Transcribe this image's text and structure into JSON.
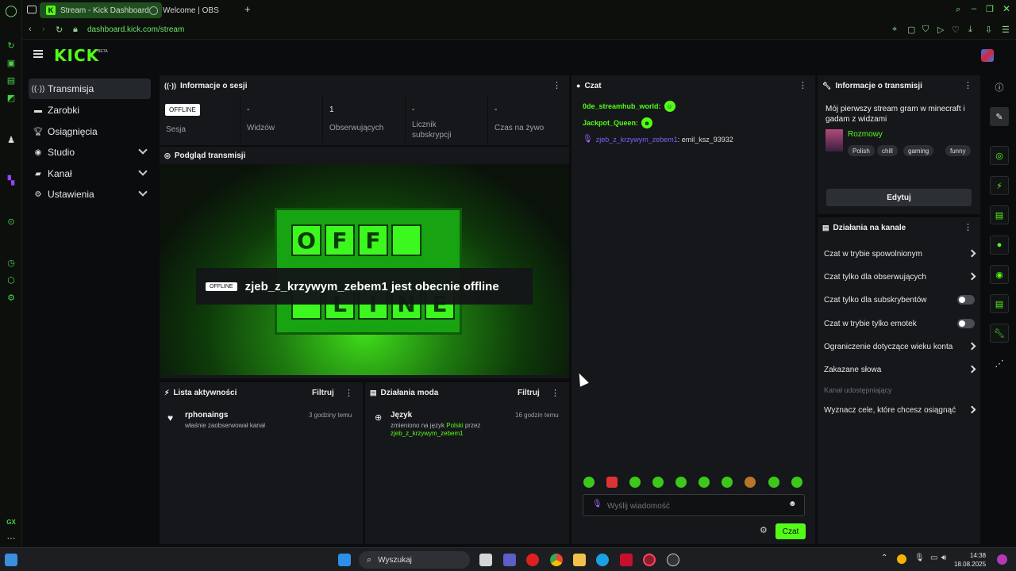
{
  "browser": {
    "tabs": [
      {
        "label": "Stream - Kick Dashboard",
        "favicon": "K"
      },
      {
        "label": "Welcome | OBS"
      }
    ],
    "new_tab_symbol": "+",
    "url": "dashboard.kick.com/stream"
  },
  "header": {
    "logo": "KICK",
    "logo_tag": "BETA"
  },
  "nav": {
    "items": [
      {
        "label": "Transmisja",
        "icon": "broadcast-icon",
        "active": true
      },
      {
        "label": "Zarobki",
        "icon": "money-icon"
      },
      {
        "label": "Osiągnięcia",
        "icon": "trophy-icon"
      },
      {
        "label": "Studio",
        "icon": "studio-icon",
        "expandable": true
      },
      {
        "label": "Kanał",
        "icon": "channel-icon",
        "expandable": true
      },
      {
        "label": "Ustawienia",
        "icon": "gear-icon",
        "expandable": true
      }
    ]
  },
  "session": {
    "title": "Informacje o sesji",
    "status_pill": "OFFLINE",
    "stats": [
      {
        "label": "Sesja"
      },
      {
        "value": "-",
        "label": "Widzów"
      },
      {
        "value": "1",
        "label": "Obserwujących"
      },
      {
        "value": "-",
        "label": "Licznik subskrypcji"
      },
      {
        "value": "-",
        "label": "Czas na żywo"
      }
    ]
  },
  "preview": {
    "title": "Podgląd transmisji",
    "sign_letters": [
      "O",
      "F",
      "F",
      "",
      "L",
      "I",
      "N",
      "E"
    ],
    "banner_pill": "OFFLINE",
    "banner_text": "zjeb_z_krzywym_zebem1 jest obecnie offline"
  },
  "activity": {
    "title": "Lista aktywności",
    "filter": "Filtruj",
    "items": [
      {
        "user": "rphonaings",
        "text": "właśnie zaobserwował kanał",
        "time": "3 godziny temu"
      }
    ]
  },
  "mod": {
    "title": "Działania moda",
    "filter": "Filtruj",
    "items": [
      {
        "title": "Język",
        "text_a": "zmieniono na język ",
        "lang": "Polski",
        "text_b": " przez",
        "by": "zjeb_z_krzywym_zebem1",
        "time": "16 godzin temu"
      }
    ]
  },
  "chat": {
    "title": "Czat",
    "messages": [
      {
        "user": "0de_streamhub_world:",
        "color": "#53fc18"
      },
      {
        "user": "Jackpot_Queen:",
        "color": "#53fc18"
      },
      {
        "user": "zjeb_z_krzywym_zebem1",
        "text": ": emil_ksz_93932",
        "color": "#7b61ff"
      }
    ],
    "input_placeholder": "Wyślij wiadomość",
    "send_label": "Czat"
  },
  "stream_info": {
    "title": "Informacje o transmisji",
    "stream_title": "Mój pierwszy stream gram w minecraft i gadam z widzami",
    "category": "Rozmowy",
    "tags": [
      "Polish",
      "chill",
      "gaming",
      "funny"
    ],
    "edit_label": "Edytuj"
  },
  "channel_actions": {
    "title": "Działania na kanale",
    "rows": [
      {
        "label": "Czat w trybie spowolnionym",
        "control": "chevron"
      },
      {
        "label": "Czat tylko dla obserwujących",
        "control": "chevron"
      },
      {
        "label": "Czat tylko dla subskrybentów",
        "control": "toggle"
      },
      {
        "label": "Czat w trybie tylko emotek",
        "control": "toggle"
      },
      {
        "label": "Ograniczenie dotyczące wieku konta",
        "control": "chevron"
      },
      {
        "label": "Zakazane słowa",
        "control": "chevron"
      },
      {
        "label": "Kanał udostępniający",
        "control": "none",
        "disabled": true
      },
      {
        "label": "Wyznacz cele, które chcesz osiągnąć",
        "control": "chevron"
      }
    ]
  },
  "taskbar": {
    "search_label": "Wyszukaj",
    "time": "14:38",
    "date": "18.08.2025"
  },
  "accent_color": "#53fc18"
}
